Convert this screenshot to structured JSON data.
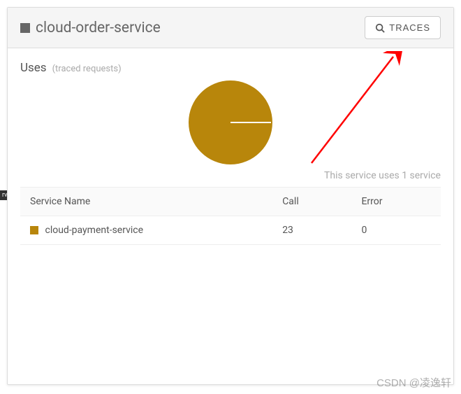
{
  "header": {
    "service_name": "cloud-order-service",
    "traces_button": "TRACES"
  },
  "body": {
    "uses_label": "Uses",
    "uses_sub": "(traced requests)",
    "summary": "This service uses 1 service"
  },
  "table": {
    "columns": [
      "Service Name",
      "Call",
      "Error"
    ],
    "rows": [
      {
        "service": "cloud-payment-service",
        "call": "23",
        "error": "0",
        "color": "#b8860b"
      }
    ]
  },
  "chart_data": {
    "type": "pie",
    "title": "",
    "series": [
      {
        "name": "cloud-payment-service",
        "value": 23,
        "color": "#b8860b"
      }
    ]
  },
  "watermark": "CSDN @凌逸轩",
  "side_tag": "rvi"
}
